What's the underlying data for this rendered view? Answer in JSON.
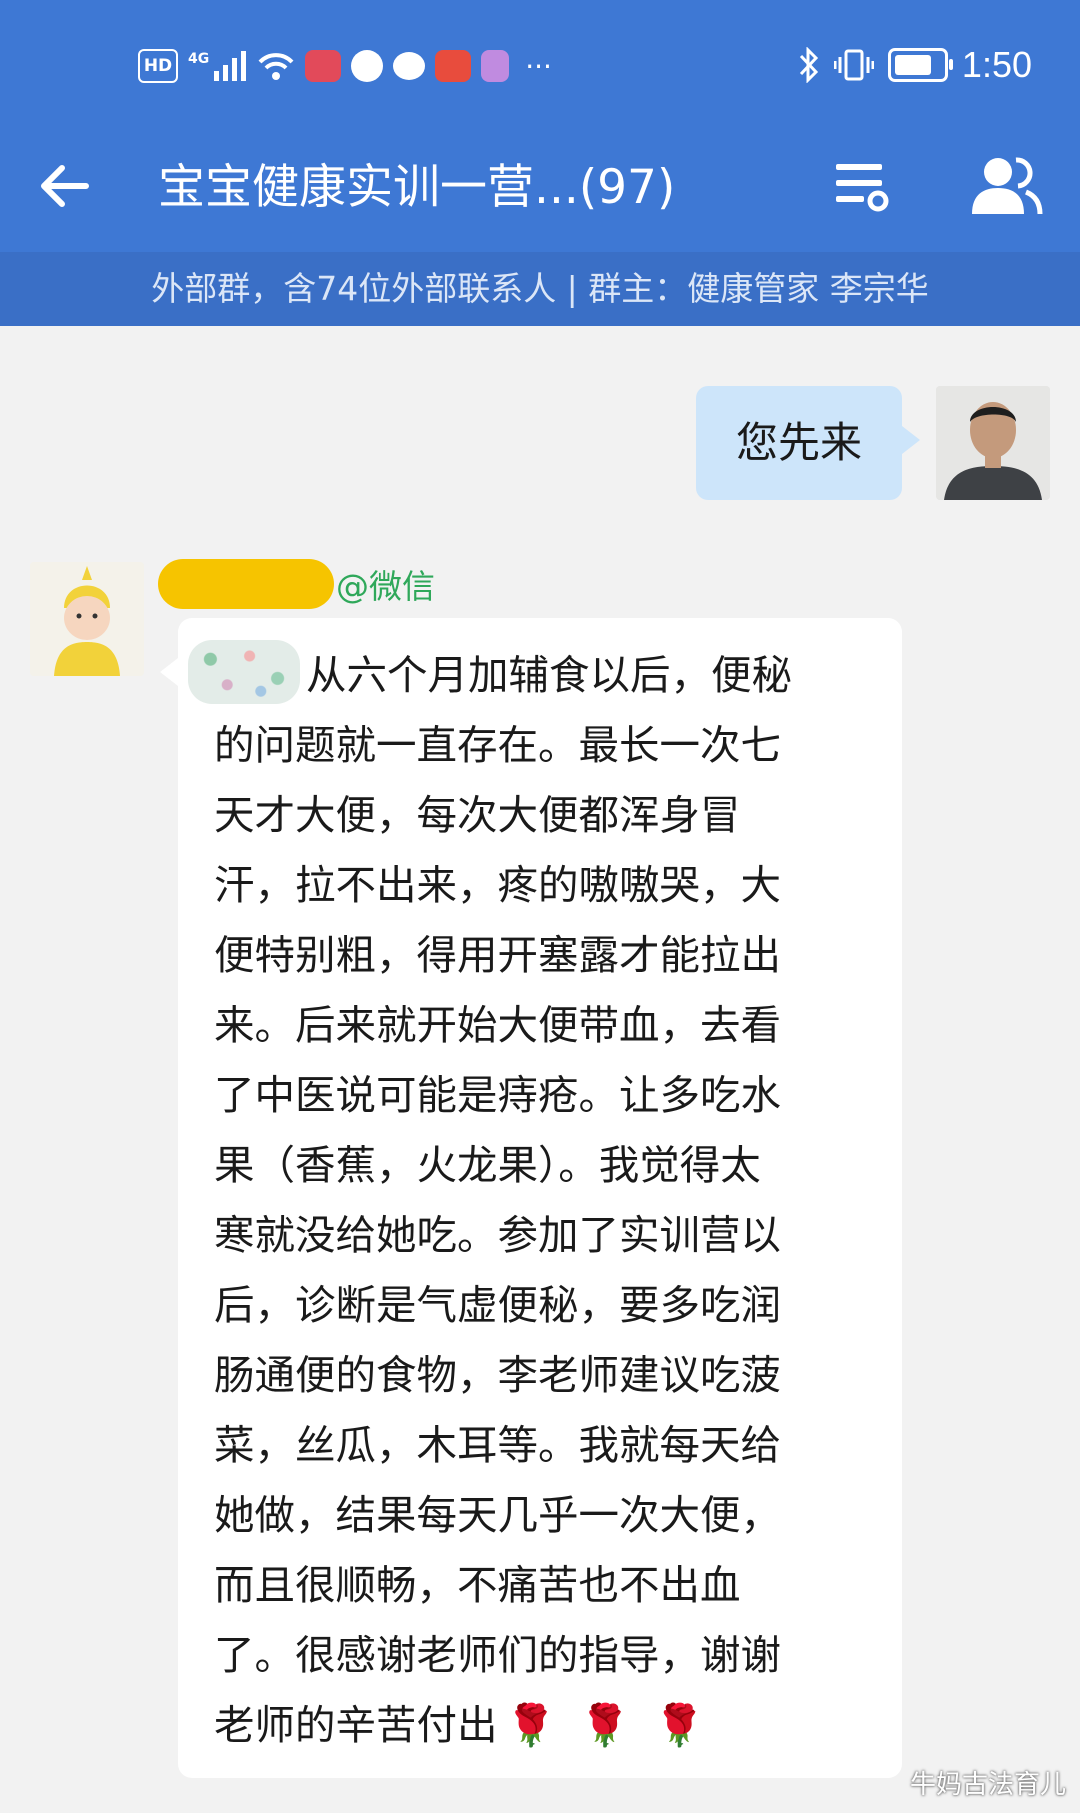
{
  "status_bar": {
    "hd": "HD",
    "network": "4G",
    "time": "1:50",
    "battery_level": 0.85
  },
  "header": {
    "title": "宝宝健康实训一营...(97)"
  },
  "group_info": "外部群，含74位外部联系人 | 群主：健康管家 李宗华",
  "messages": {
    "outgoing": {
      "text": "您先来"
    },
    "incoming": {
      "sender_source": "@微信",
      "lines": [
        "从六个月加辅食以后，便秘",
        "的问题就一直存在。最长一次七",
        "天才大便，每次大便都浑身冒",
        "汗，拉不出来，疼的嗷嗷哭，大",
        "便特别粗，得用开塞露才能拉出",
        "来。后来就开始大便带血，去看",
        "了中医说可能是痔疮。让多吃水",
        "果（香蕉，火龙果）。我觉得太",
        "寒就没给她吃。参加了实训营以",
        "后，诊断是气虚便秘，要多吃润",
        "肠通便的食物，李老师建议吃菠",
        "菜，丝瓜，木耳等。我就每天给",
        "她做，结果每天几乎一次大便，",
        "而且很顺畅，不痛苦也不出血",
        "了。很感谢老师们的指导，谢谢",
        "老师的辛苦付出"
      ],
      "emoji": "🌹🌹🌹"
    }
  },
  "watermark": "牛妈古法育儿",
  "colors": {
    "header_bg": "#3e78d4",
    "subbar_bg": "#3a6fc6",
    "outgoing_bubble": "#cde5fa",
    "wechat_tag": "#2fa85a"
  }
}
